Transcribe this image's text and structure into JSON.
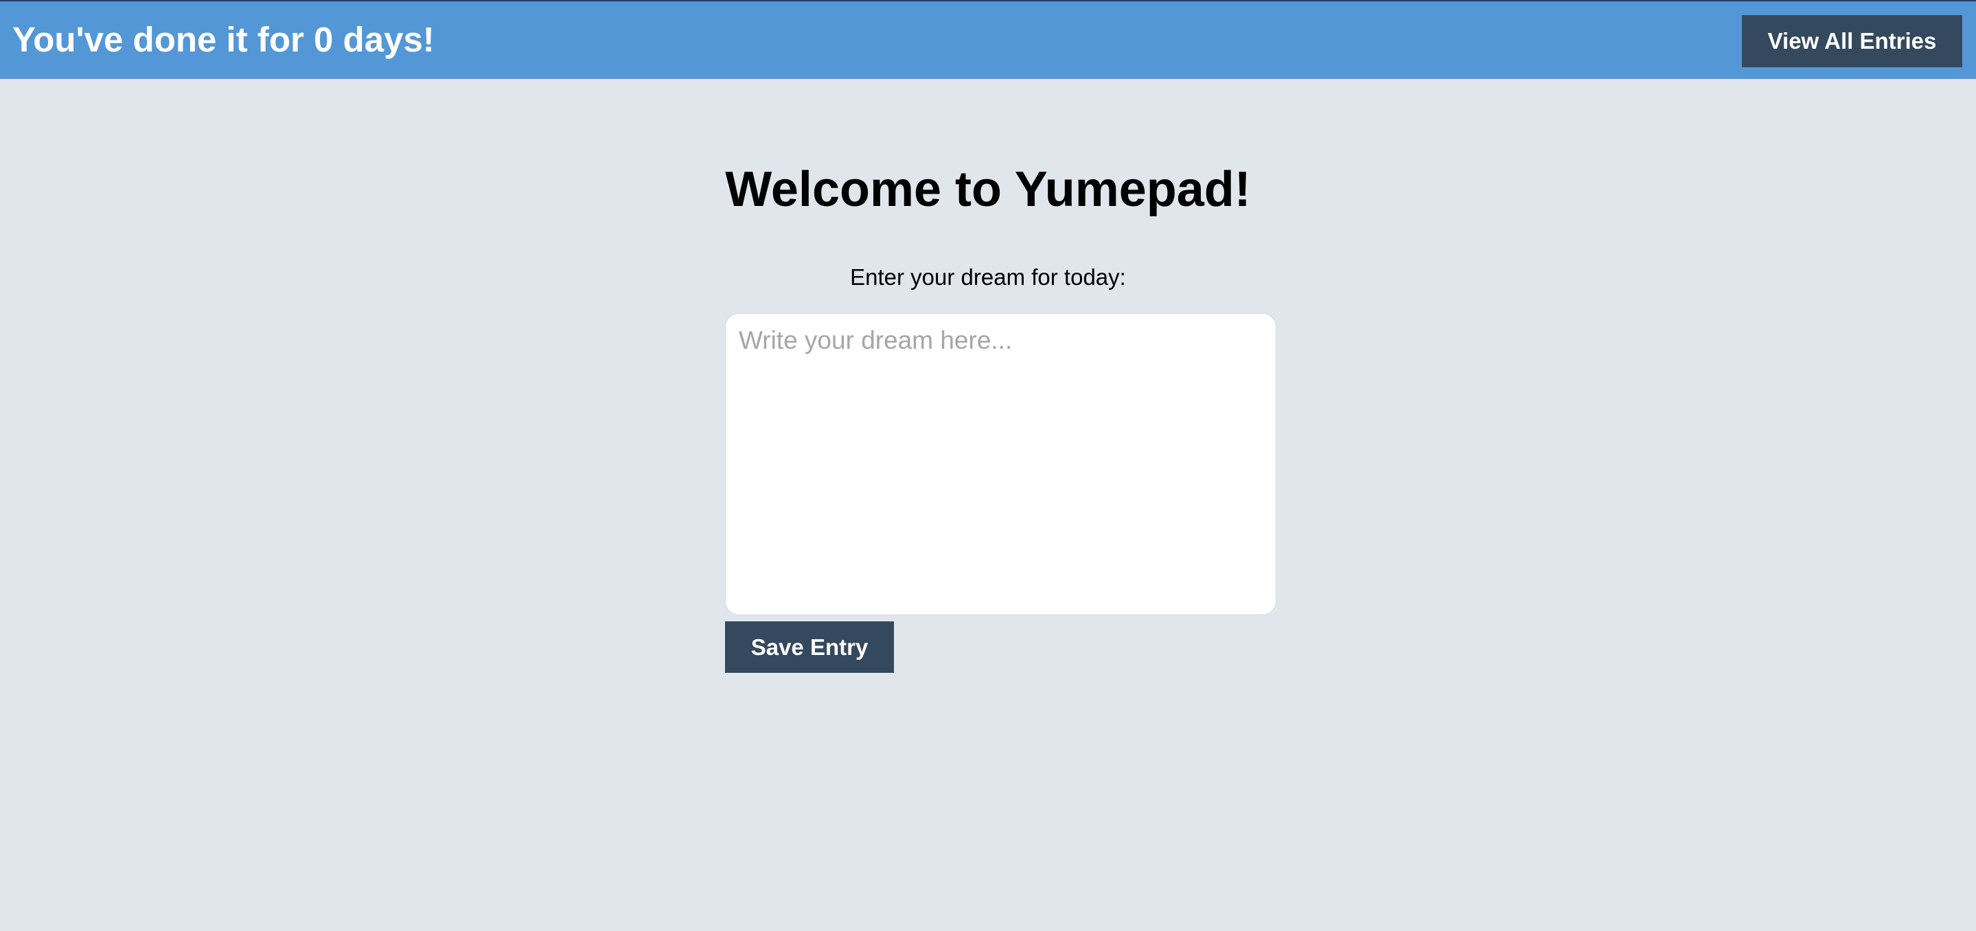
{
  "header": {
    "streak_text": "You've done it for 0 days!",
    "view_all_label": "View All Entries"
  },
  "main": {
    "title": "Welcome to Yumepad!",
    "prompt": "Enter your dream for today:",
    "dream_input": {
      "value": "",
      "placeholder": "Write your dream here..."
    },
    "save_label": "Save Entry"
  },
  "colors": {
    "header_bg": "#5497d6",
    "page_bg": "#e0e6eb",
    "button_bg": "#34495e",
    "button_text": "#ffffff"
  }
}
